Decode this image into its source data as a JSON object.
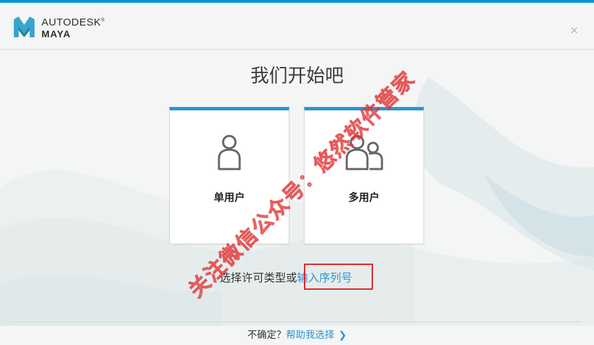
{
  "brand": {
    "line1": "AUTODESK",
    "reg_mark": "®",
    "line2": "MAYA"
  },
  "window": {
    "close_glyph": "×"
  },
  "title": "我们开始吧",
  "cards": {
    "single_label": "单用户",
    "multi_label": "多用户"
  },
  "license": {
    "prompt": "选择许可类型或",
    "serial_link": "输入序列号"
  },
  "footer": {
    "unsure": "不确定？",
    "help_link": "帮助我选择",
    "chevron": "❯"
  },
  "watermark": "关注微信公众号：悠然软件管家",
  "colors": {
    "accent": "#2a96d3",
    "topbar": "#0696d7",
    "highlight": "#e32323",
    "logo": "#37a5cc"
  }
}
